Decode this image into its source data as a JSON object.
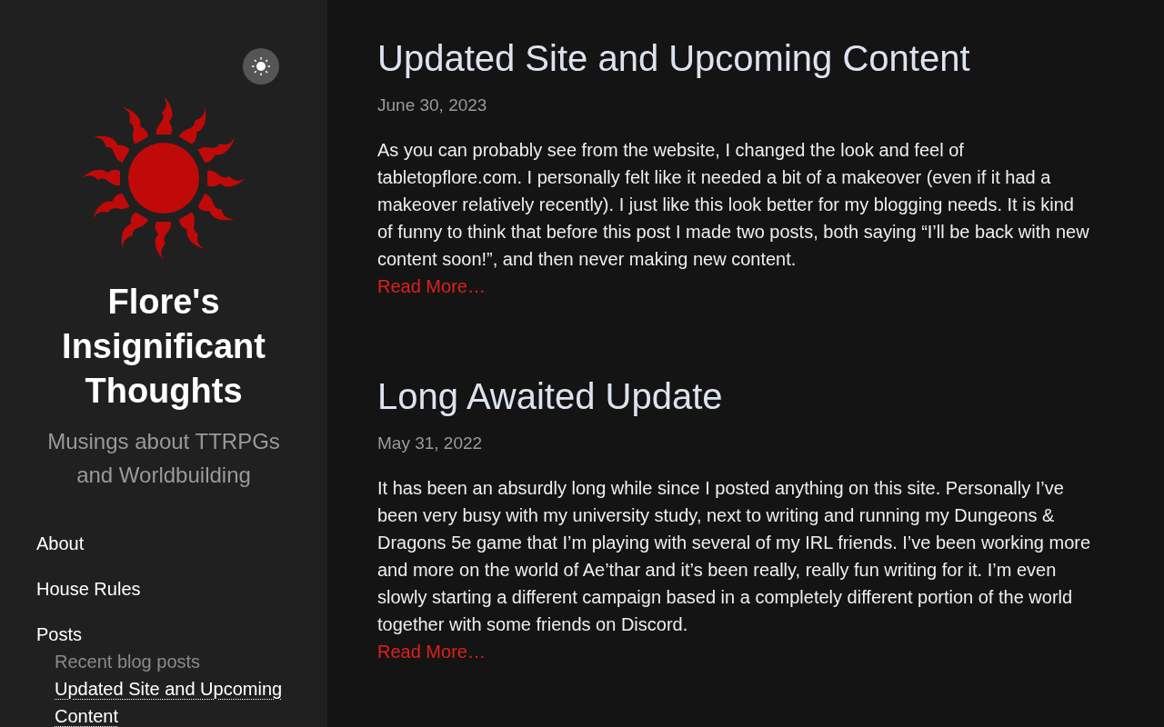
{
  "sidebar": {
    "theme_toggle": {
      "on": false
    },
    "site_title": "Flore's Insignificant Thoughts",
    "tagline": "Musings about TTRPGs and Worldbuilding",
    "nav": [
      {
        "label": "About"
      },
      {
        "label": "House Rules"
      },
      {
        "label": "Posts",
        "children": [
          {
            "label": "Recent blog posts",
            "kind": "heading"
          },
          {
            "label": "Updated Site and Upcoming Content",
            "kind": "post"
          }
        ]
      }
    ]
  },
  "posts": [
    {
      "title": "Updated Site and Upcoming Content",
      "date": "June 30, 2023",
      "excerpt": "As you can probably see from the website, I changed the look and feel of tabletopflore.com. I personally felt like it needed a bit of a makeover (even if it had a makeover relatively recently). I just like this look better for my blogging needs. It is kind of funny to think that before this post I made two posts, both saying “I’ll be back with new content soon!”, and then never making new content.",
      "read_more": "Read More…"
    },
    {
      "title": "Long Awaited Update",
      "date": "May 31, 2022",
      "excerpt": "It has been an absurdly long while since I posted anything on this site. Personally I’ve been very busy with my university study, next to writing and running my Dungeons & Dragons 5e game that I’m playing with several of my IRL friends. I’ve been working more and more on the world of Ae’thar and it’s been really, really fun writing for it. I’m even slowly starting a different campaign based in a completely different portion of the world together with some friends on Discord.",
      "read_more": "Read More…"
    }
  ]
}
